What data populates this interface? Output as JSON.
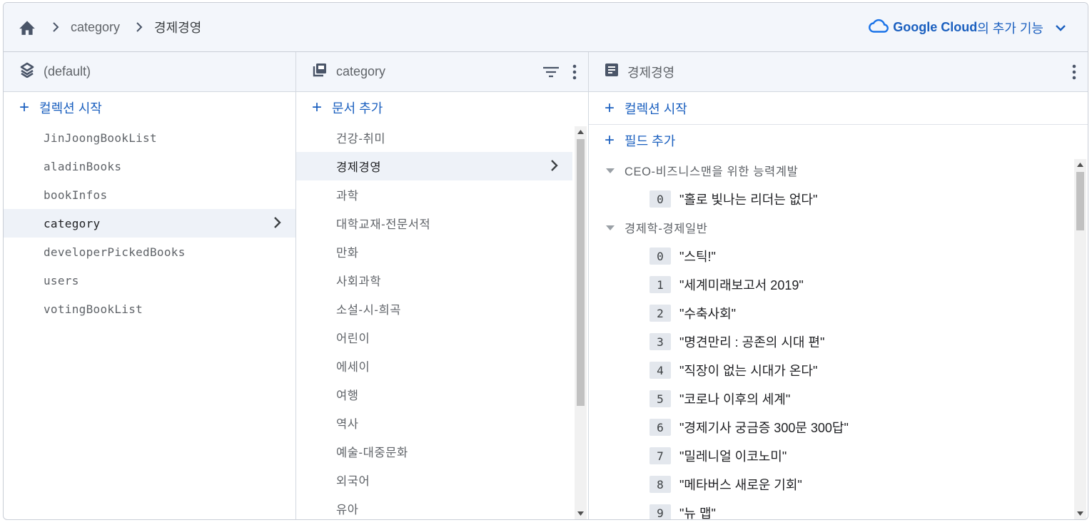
{
  "breadcrumb": {
    "items": [
      "category",
      "경제경영"
    ]
  },
  "google_cloud": {
    "brand": "Google Cloud",
    "rest": "의 추가 기능"
  },
  "col1": {
    "title": "(default)",
    "add_label": "컬렉션 시작",
    "items": [
      "JinJoongBookList",
      "aladinBooks",
      "bookInfos",
      "category",
      "developerPickedBooks",
      "users",
      "votingBookList"
    ],
    "selected": "category"
  },
  "col2": {
    "title": "category",
    "add_label": "문서 추가",
    "items": [
      "건강-취미",
      "경제경영",
      "과학",
      "대학교재-전문서적",
      "만화",
      "사회과학",
      "소설-시-희곡",
      "어린이",
      "에세이",
      "여행",
      "역사",
      "예술-대중문화",
      "외국어",
      "유아"
    ],
    "selected": "경제경영"
  },
  "col3": {
    "title": "경제경영",
    "add_collection_label": "컬렉션 시작",
    "add_field_label": "필드 추가",
    "groups": [
      {
        "name": "CEO-비즈니스맨을 위한 능력계발",
        "items": [
          "\"홀로 빛나는 리더는 없다\""
        ]
      },
      {
        "name": "경제학-경제일반",
        "items": [
          "\"스틱!\"",
          "\"세계미래보고서 2019\"",
          "\"수축사회\"",
          "\"명견만리 : 공존의 시대 편\"",
          "\"직장이 없는 시대가 온다\"",
          "\"코로나 이후의 세계\"",
          "\"경제기사 궁금증 300문 300답\"",
          "\"밀레니얼 이코노미\"",
          "\"메타버스 새로운 기회\"",
          "\"뉴 맵\""
        ]
      }
    ]
  },
  "colors": {
    "accent": "#1a73e8",
    "selected_bg": "#eef2f8",
    "header_bg": "#f3f6fb"
  },
  "icons": [
    "home-icon",
    "chevron-right-icon",
    "cloud-icon",
    "chevron-down-icon",
    "database-icon",
    "collection-icon",
    "filter-icon",
    "more-vert-icon",
    "document-icon",
    "plus-icon",
    "caret-down-icon"
  ]
}
